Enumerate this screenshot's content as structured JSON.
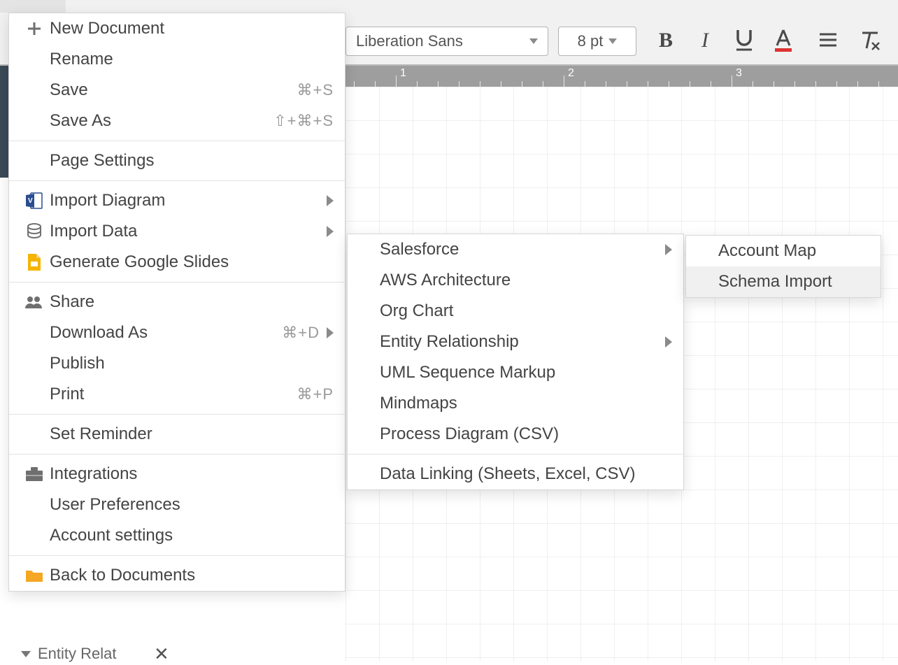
{
  "toolbar": {
    "font_name": "Liberation Sans",
    "font_size": "8 pt",
    "bold_glyph": "B",
    "italic_glyph": "I"
  },
  "ruler": {
    "marks": [
      "1",
      "2",
      "3"
    ]
  },
  "file_menu": {
    "new_document": "New Document",
    "rename": "Rename",
    "save": "Save",
    "save_shortcut": "⌘+S",
    "save_as": "Save As",
    "save_as_shortcut": "⇧+⌘+S",
    "page_settings": "Page Settings",
    "import_diagram": "Import Diagram",
    "import_data": "Import Data",
    "generate_slides": "Generate Google Slides",
    "share": "Share",
    "download_as": "Download As",
    "download_as_shortcut": "⌘+D",
    "publish": "Publish",
    "print": "Print",
    "print_shortcut": "⌘+P",
    "set_reminder": "Set Reminder",
    "integrations": "Integrations",
    "user_preferences": "User Preferences",
    "account_settings": "Account settings",
    "back_to_documents": "Back to Documents"
  },
  "import_data_menu": {
    "salesforce": "Salesforce",
    "aws": "AWS Architecture",
    "org_chart": "Org Chart",
    "entity_relationship": "Entity Relationship",
    "uml": "UML Sequence Markup",
    "mindmaps": "Mindmaps",
    "process_csv": "Process Diagram (CSV)",
    "data_linking": "Data Linking (Sheets, Excel, CSV)"
  },
  "salesforce_menu": {
    "account_map": "Account Map",
    "schema_import": "Schema Import"
  },
  "shape_panel": {
    "title": "Entity Relat"
  }
}
